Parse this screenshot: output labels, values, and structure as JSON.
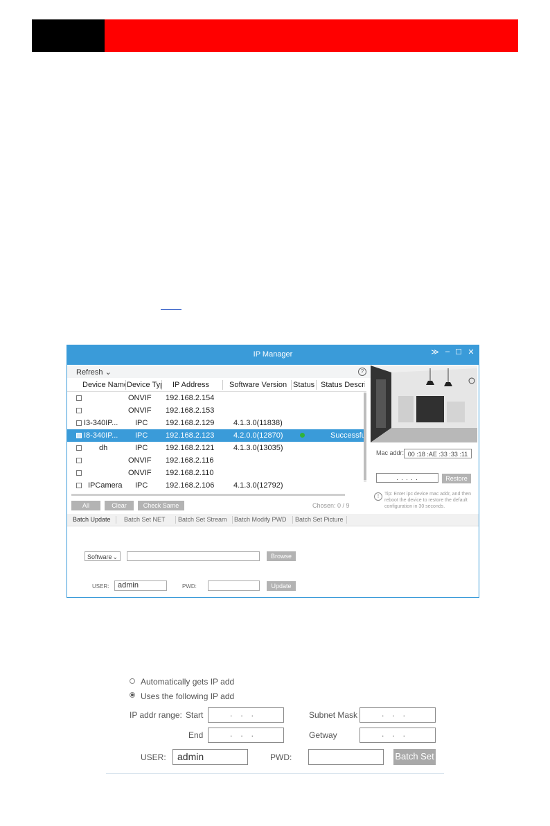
{
  "header": {
    "black_color": "#000000",
    "red_color": "#ff0000"
  },
  "window": {
    "title": "IP Manager",
    "controls": {
      "collapse": "≫",
      "minimize": "–",
      "maximize": "☐",
      "close": "✕"
    },
    "toolbar": {
      "refresh_label": "Refresh",
      "refresh_chevron": "⌄",
      "help_icon": "?"
    },
    "columns": [
      "Device Name",
      "Device Type",
      "IP Address",
      "Software Version",
      "Status",
      "Status Descrip"
    ],
    "rows": [
      {
        "name": "",
        "type": "ONVIF",
        "ip": "192.168.2.154",
        "version": "",
        "desc": "",
        "selected": false,
        "status": false
      },
      {
        "name": "",
        "type": "ONVIF",
        "ip": "192.168.2.153",
        "version": "",
        "desc": "",
        "selected": false,
        "status": false
      },
      {
        "name": "I3-340IP...",
        "type": "IPC",
        "ip": "192.168.2.129",
        "version": "4.1.3.0(11838)",
        "desc": "",
        "selected": false,
        "status": false
      },
      {
        "name": "I8-340IP...",
        "type": "IPC",
        "ip": "192.168.2.123",
        "version": "4.2.0.0(12870)",
        "desc": "Successful",
        "selected": true,
        "status": true
      },
      {
        "name": "dh",
        "type": "IPC",
        "ip": "192.168.2.121",
        "version": "4.1.3.0(13035)",
        "desc": "",
        "selected": false,
        "status": false
      },
      {
        "name": "",
        "type": "ONVIF",
        "ip": "192.168.2.116",
        "version": "",
        "desc": "",
        "selected": false,
        "status": false
      },
      {
        "name": "",
        "type": "ONVIF",
        "ip": "192.168.2.110",
        "version": "",
        "desc": "",
        "selected": false,
        "status": false
      },
      {
        "name": "IPCamera",
        "type": "IPC",
        "ip": "192.168.2.106",
        "version": "4.1.3.0(12792)",
        "desc": "",
        "selected": false,
        "status": false
      }
    ],
    "buttons": {
      "all": "All",
      "clear": "Clear",
      "check_same": "Check Same Type",
      "chosen": "Chosen: 0 / 9"
    },
    "camera": {
      "mac_label": "Mac addr:",
      "mac_value": "00 :18 :AE :33 :33 :11",
      "ip_value": ". . . . .",
      "restore": "Restore",
      "tip_icon": "!",
      "tip": "Tip: Enter ipc device mac addr, and then reboot the device to restore the default configuration in 30 seconds."
    },
    "tabs": [
      "Batch Update",
      "Batch Set NET",
      "Batch Set Stream",
      "Batch Modify PWD",
      "Batch Set Picture"
    ],
    "update_form": {
      "select_value": "Software",
      "select_chevron": "⌄",
      "browse": "Browse",
      "user_label": "USER:",
      "user_value": "admin",
      "pwd_label": "PWD:",
      "update": "Update"
    }
  },
  "net_form": {
    "auto_ip": "Automatically gets IP add",
    "use_ip": "Uses the following IP add",
    "range_label": "IP addr range:",
    "start_label": "Start",
    "end_label": "End",
    "subnet_label": "Subnet Mask",
    "gateway_label": "Getway",
    "ip_placeholder": "...",
    "user_label": "USER:",
    "user_value": "admin",
    "pwd_label": "PWD:",
    "batch_set": "Batch Set"
  }
}
